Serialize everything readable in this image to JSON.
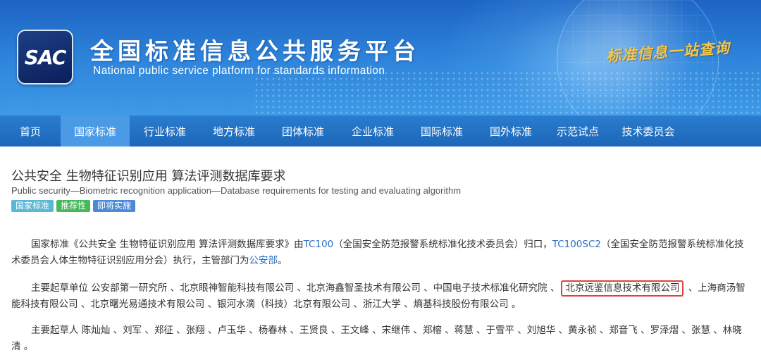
{
  "header": {
    "logo_text": "SAC",
    "title_cn": "全国标准信息公共服务平台",
    "title_en": "National public service platform  for standards information",
    "slogan": "标准信息一站查询"
  },
  "nav": {
    "items": [
      {
        "label": "首页"
      },
      {
        "label": "国家标准"
      },
      {
        "label": "行业标准"
      },
      {
        "label": "地方标准"
      },
      {
        "label": "团体标准"
      },
      {
        "label": "企业标准"
      },
      {
        "label": "国际标准"
      },
      {
        "label": "国外标准"
      },
      {
        "label": "示范试点"
      },
      {
        "label": "技术委员会"
      }
    ],
    "active_index": 1
  },
  "standard": {
    "title_cn": "公共安全 生物特征识别应用 算法评测数据库要求",
    "title_en": "Public security—Biometric recognition application—Database requirements for testing and evaluating algorithm",
    "tags": [
      "国家标准",
      "推荐性",
      "即将实施"
    ]
  },
  "para1": {
    "t1": "国家标准《公共安全 生物特征识别应用 算法评测数据库要求》由",
    "link1": "TC100",
    "t2": "（全国安全防范报警系统标准化技术委员会）归口，",
    "link2": "TC100SC2",
    "t3": "（全国安全防范报警系统标准化技术委员会人体生物特征识别应用分会）执行，主管部门为",
    "link3": "公安部",
    "t4": "。"
  },
  "para2": {
    "t1": "主要起草单位 公安部第一研究所 、北京眼神智能科技有限公司 、北京海鑫智圣技术有限公司 、中国电子技术标准化研究院 、",
    "highlight": "北京远鉴信息技术有限公司",
    "t2": " 、上海商汤智能科技有限公司 、北京曙光易通技术有限公司 、银河水滴（科技）北京有限公司 、浙江大学 、熵基科技股份有限公司 。"
  },
  "para3": {
    "text": "主要起草人 陈灿灿 、刘军 、郑征 、张翔 、卢玉华 、杨春林 、王贤良 、王文峰 、宋继伟 、郑榕 、蒋慧 、于雪平 、刘旭华 、黄永祯 、郑音飞 、罗泽熠 、张慧 、林晓清 。"
  },
  "colors": {
    "nav_bg": "#1c66b8",
    "nav_active": "#4a9ae6",
    "link": "#2b6fc2",
    "highlight_border": "#e0423a"
  }
}
